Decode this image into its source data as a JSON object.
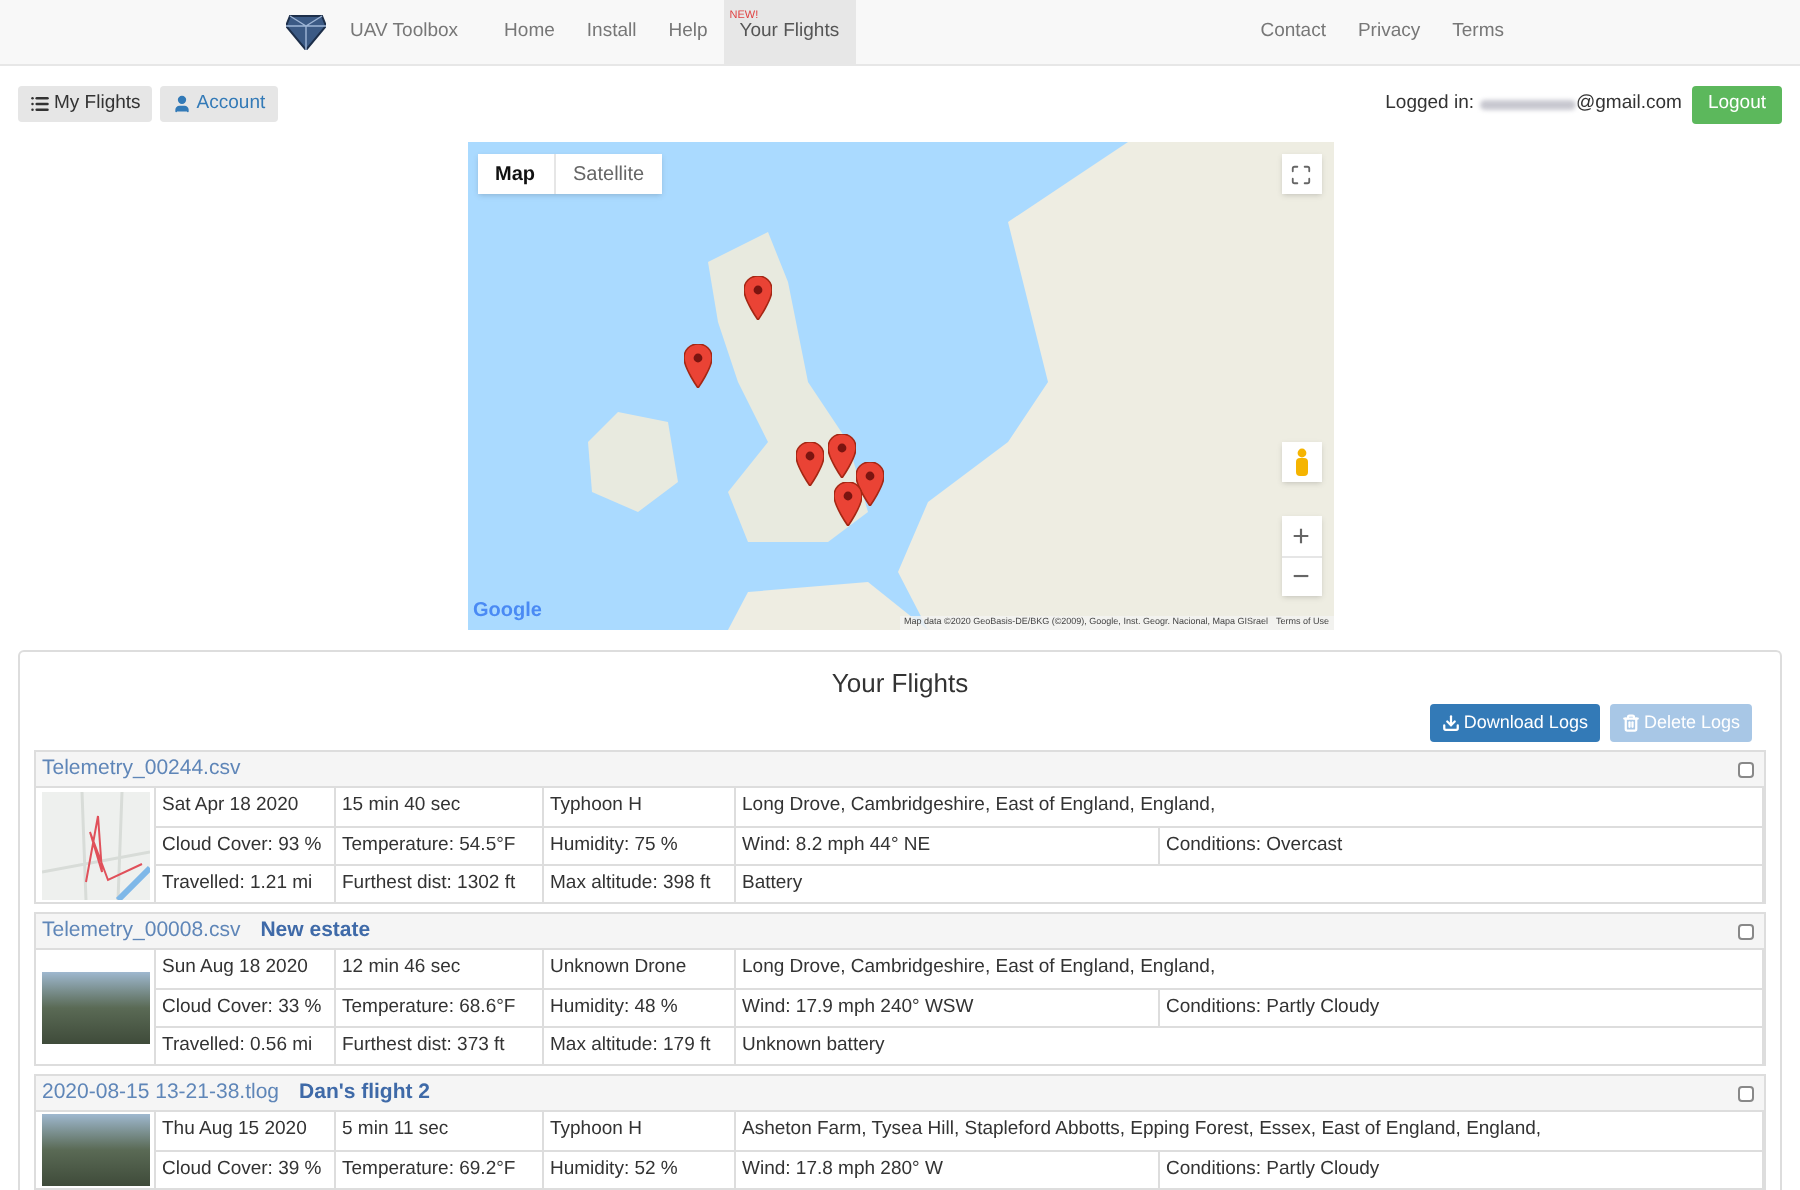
{
  "navbar": {
    "brand": "UAV Toolbox",
    "items": [
      {
        "label": "Home",
        "selected": false
      },
      {
        "label": "Install",
        "selected": false
      },
      {
        "label": "Help",
        "selected": false
      },
      {
        "label": "Your Flights",
        "selected": true,
        "badge": "NEW!"
      }
    ],
    "right_items": [
      "Contact",
      "Privacy",
      "Terms"
    ]
  },
  "toolbar": {
    "buttons": [
      {
        "label": "My Flights",
        "kind": "list"
      },
      {
        "label": "Account",
        "kind": "user"
      }
    ],
    "login_label": "Logged in:",
    "email": "@gmail.com",
    "logout": "Logout"
  },
  "map": {
    "tabs": [
      {
        "label": "Map",
        "selected": true
      },
      {
        "label": "Satellite",
        "selected": false
      }
    ],
    "logo": "Google",
    "attribution": "Map data ©2020 GeoBasis-DE/BKG (©2009), Google, Inst. Geogr. Nacional, Mapa GISrael",
    "terms": "Terms of Use",
    "zoom_in": "+",
    "zoom_out": "−"
  },
  "flights_panel": {
    "title": "Your Flights",
    "download": {
      "label": "Download Logs",
      "disabled": false
    },
    "delete": {
      "label": "Delete Logs",
      "disabled": true
    },
    "flights": [
      {
        "file": "Telemetry_00244.csv",
        "checked": false,
        "kind": "track",
        "rows": [
          [
            "Sat Apr 18 2020",
            "15 min 40 sec",
            "Typhoon H",
            "Long Drove,  Cambridgeshire, East of England, England,"
          ],
          [
            "Cloud Cover: 93 %",
            "Temperature: 54.5°F",
            "Humidity: 75 %",
            "Wind: 8.2 mph 44°  NE",
            "Conditions: Overcast"
          ],
          [
            "Travelled: 1.21 mi",
            "Furthest dist: 1302 ft",
            "Max altitude: 398 ft",
            "Battery"
          ]
        ]
      },
      {
        "file": "Telemetry_00008.csv",
        "name": "New estate",
        "checked": false,
        "kind": "photo",
        "rows": [
          [
            "Sun Aug 18 2020",
            "12 min 46 sec",
            "Unknown Drone",
            "Long Drove, Cambridgeshire, East of England, England,"
          ],
          [
            "Cloud Cover: 33 %",
            "Temperature: 68.6°F",
            "Humidity: 48 %",
            "Wind: 17.9 mph 240°  WSW",
            "Conditions: Partly Cloudy"
          ],
          [
            "Travelled: 0.56 mi",
            "Furthest dist: 373 ft",
            "Max altitude: 179 ft",
            "Unknown battery"
          ]
        ]
      },
      {
        "file": "2020-08-15 13-21-38.tlog",
        "name": "Dan's flight 2",
        "checked": false,
        "kind": "photo",
        "rows": [
          [
            "Thu Aug 15 2020",
            "5 min 11 sec",
            "Typhoon H",
            "Asheton Farm, Tysea Hill, Stapleford Abbotts, Epping Forest, Essex, East of England, England,"
          ],
          [
            "Cloud Cover: 39 %",
            "Temperature: 69.2°F",
            "Humidity: 52 %",
            "Wind: 17.8 mph 280°  W",
            "Conditions: Partly Cloudy"
          ]
        ]
      }
    ]
  }
}
